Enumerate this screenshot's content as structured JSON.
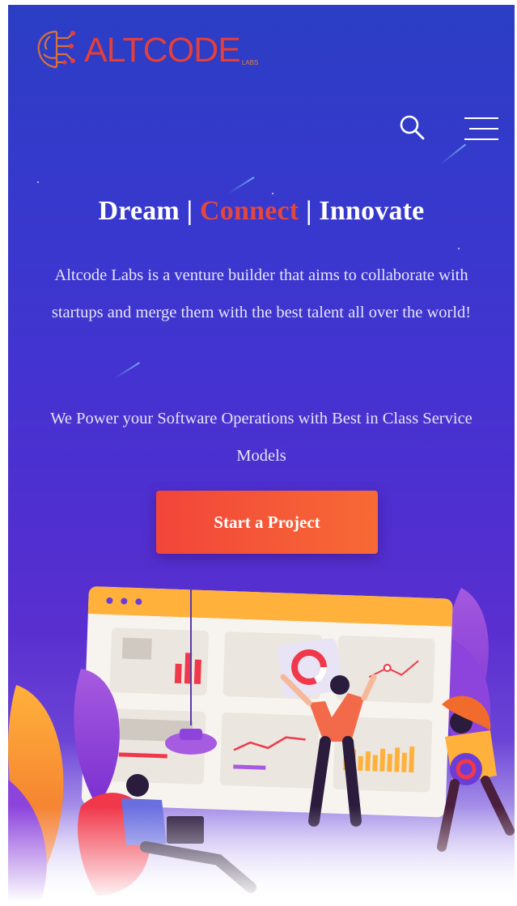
{
  "brand": {
    "name": "ALTCODE",
    "sub": "LABS",
    "color": "#e2403f"
  },
  "header": {
    "search_icon": "search-icon",
    "menu_icon": "hamburger-menu-icon"
  },
  "hero": {
    "headline_part1": "Dream | ",
    "headline_accent": "Connect",
    "headline_part3": " | Innovate",
    "description": "Altcode Labs is a venture builder that aims to collaborate with startups and merge them with the best talent all over the world!",
    "tagline": "We Power your Software Operations with Best in Class Service Models",
    "cta_label": "Start a Project"
  },
  "colors": {
    "accent": "#e2483f",
    "background_top": "#2b3ec4",
    "background_bottom": "#5a2fd0",
    "button": "#f2453a"
  }
}
